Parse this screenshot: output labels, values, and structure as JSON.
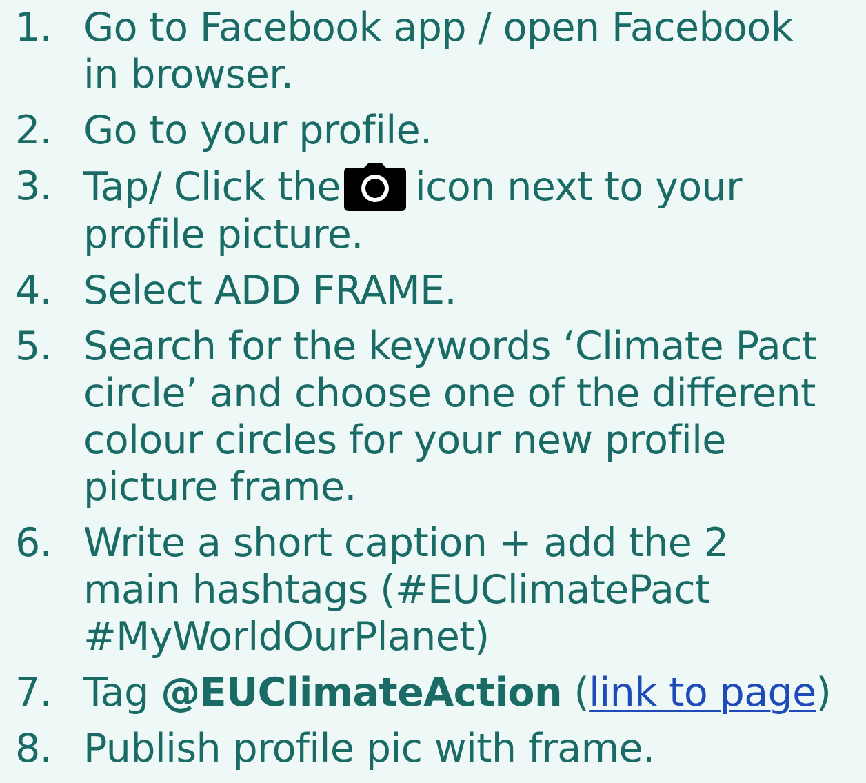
{
  "steps": [
    {
      "number": "1.",
      "lines": [
        "Go to Facebook app / open Facebook",
        "in browser."
      ]
    },
    {
      "number": "2.",
      "lines": [
        "Go to your profile."
      ]
    },
    {
      "number": "3.",
      "before_icon": "Tap/ Click the",
      "icon": "camera-icon",
      "after_icon": "icon next to your",
      "line2": "profile picture."
    },
    {
      "number": "4.",
      "lines": [
        "Select ADD FRAME."
      ]
    },
    {
      "number": "5.",
      "lines": [
        "Search for the keywords ‘Climate Pact",
        "circle’ and choose one of the different",
        "colour circles for your new profile",
        "picture frame."
      ]
    },
    {
      "number": "6.",
      "lines": [
        "Write a short caption + add the 2",
        "main hashtags (#EUClimatePact",
        "#MyWorldOurPlanet)"
      ]
    },
    {
      "number": "7.",
      "prefix": "Tag",
      "handle": "@EUClimateAction",
      "open_paren": "(",
      "link_text": "link to page",
      "close_paren": ")"
    },
    {
      "number": "8.",
      "lines": [
        "Publish profile pic with frame."
      ]
    }
  ],
  "colors": {
    "background": "#eef8f6",
    "text": "#1a6b66",
    "link": "#1f4bb8",
    "icon": "#000000"
  }
}
